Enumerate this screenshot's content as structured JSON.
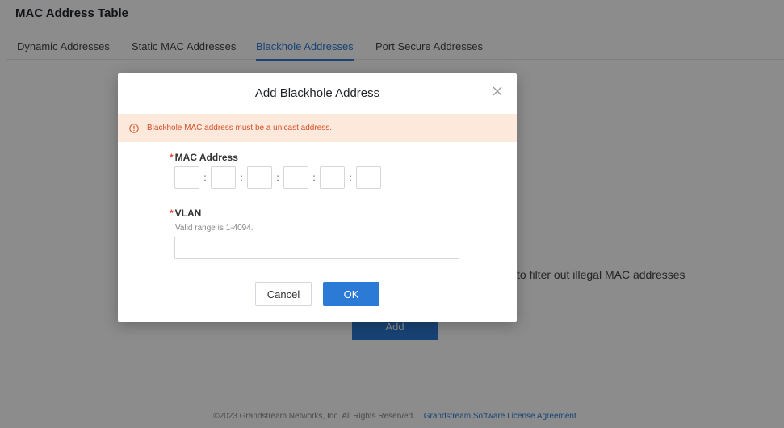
{
  "page": {
    "title": "MAC Address Table",
    "tabs": [
      {
        "label": "Dynamic Addresses",
        "active": false
      },
      {
        "label": "Static MAC Addresses",
        "active": false
      },
      {
        "label": "Blackhole Addresses",
        "active": true
      },
      {
        "label": "Port Secure Addresses",
        "active": false
      }
    ],
    "empty_description_fragment": "to filter out illegal MAC addresses",
    "add_button_label": "Add",
    "footer": {
      "copyright": "©2023 Grandstream Networks, Inc. All Rights Reserved.",
      "link_label": "Grandstream Software License Agreement"
    }
  },
  "modal": {
    "title": "Add Blackhole Address",
    "alert_text": "Blackhole MAC address must be a unicast address.",
    "mac_field": {
      "label": "MAC Address",
      "required_mark": "*",
      "separator": ":",
      "segments": [
        "",
        "",
        "",
        "",
        "",
        ""
      ]
    },
    "vlan_field": {
      "label": "VLAN",
      "required_mark": "*",
      "hint": "Valid range is 1-4094.",
      "value": ""
    },
    "cancel_label": "Cancel",
    "ok_label": "OK"
  },
  "colors": {
    "accent": "#2a7ad6",
    "alert_bg": "#fde8dc",
    "alert_text": "#d4522a",
    "required": "#e5483b"
  },
  "icons": {
    "close": "close-icon",
    "alert": "exclamation-circle-icon"
  }
}
